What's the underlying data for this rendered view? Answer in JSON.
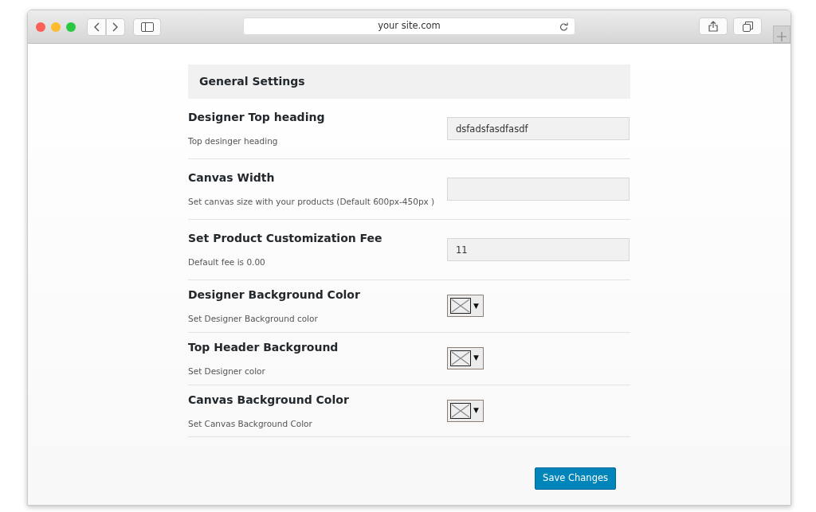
{
  "browser": {
    "address": "your site.com"
  },
  "section_title": "General Settings",
  "settings": [
    {
      "kind": "text",
      "label": "Designer Top heading",
      "description": "Top desinger heading",
      "value": "dsfadsfasdfasdf"
    },
    {
      "kind": "text",
      "label": "Canvas Width",
      "description": "Set canvas size with your products (Default 600px-450px )"
    },
    {
      "kind": "text",
      "label": "Set Product Customization Fee",
      "description": "Default fee is 0.00",
      "value": "11"
    },
    {
      "kind": "color",
      "label": "Designer Background Color",
      "description": "Set Designer Background color",
      "caret": "▼"
    },
    {
      "kind": "color",
      "label": "Top Header Background",
      "description": "Set Designer color",
      "caret": "▼"
    },
    {
      "kind": "color",
      "label": "Canvas Background Color",
      "description": "Set Canvas Background Color",
      "caret": "▼"
    }
  ],
  "save_button": "Save Changes"
}
